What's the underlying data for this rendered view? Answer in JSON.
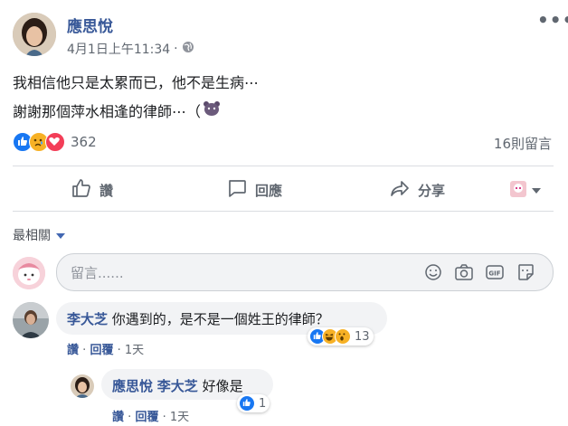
{
  "post": {
    "author": "應思悅",
    "timestamp": "4月1日上午11:34",
    "separator": "·",
    "privacy_icon": "globe-icon",
    "line1": "我相信他只是太累而已，他不是生病⋯",
    "line2": "謝謝那個萍水相逢的律師⋯（",
    "line2_emoji": "bear-emoji-icon",
    "reaction_count": "362",
    "comment_count": "16則留言"
  },
  "actions": {
    "like": "讚",
    "comment": "回應",
    "share": "分享"
  },
  "sort": {
    "label": "最相關"
  },
  "composer": {
    "placeholder": "留言......",
    "icons": [
      "emoji-icon",
      "camera-icon",
      "gif-icon",
      "sticker-icon"
    ]
  },
  "comments": [
    {
      "author": "李大芝",
      "text": "你遇到的，是不是一個姓王的律師？",
      "like": "讚",
      "sep1": "·",
      "reply": "回覆",
      "sep2": "·",
      "time": "1天",
      "reaction_count": "13"
    },
    {
      "author": "應思悅",
      "mention": "李大芝",
      "text": "好像是",
      "like": "讚",
      "sep1": "·",
      "reply": "回覆",
      "sep2": "·",
      "time": "1天",
      "reaction_count": "1"
    }
  ],
  "colors": {
    "link": "#385898",
    "like_blue": "#1877f2",
    "love_red": "#f33e58",
    "haha_yellow": "#f7b125",
    "divider": "#dadde1"
  }
}
